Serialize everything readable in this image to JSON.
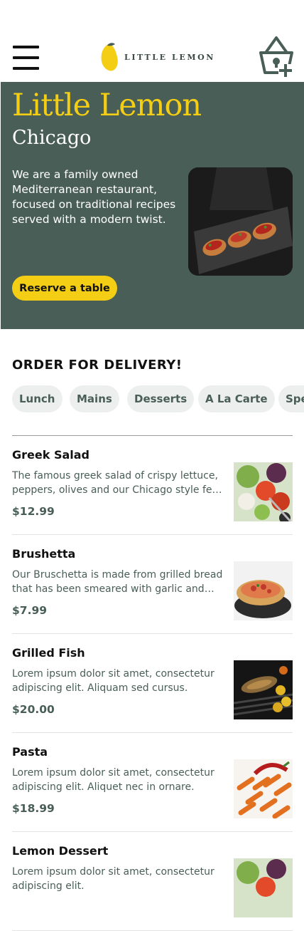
{
  "header": {
    "logo_text": "LITTLE LEMON",
    "menu_icon": "hamburger-icon",
    "cart_icon": "basket-add-icon"
  },
  "hero": {
    "title": "Little Lemon",
    "subtitle": "Chicago",
    "description": "We are a family owned Mediterranean restaurant, focused on traditional recipes served with a modern twist.",
    "button": "Reserve a table"
  },
  "order": {
    "title": "ORDER FOR DELIVERY!",
    "categories": [
      "Lunch",
      "Mains",
      "Desserts",
      "A La Carte",
      "Specials"
    ]
  },
  "menu": [
    {
      "name": "Greek Salad",
      "description": "The famous greek salad of crispy lettuce, peppers, olives and our Chicago style feta cheese, garnished with crunchy garlic and rosemary croutons.",
      "price": "$12.99"
    },
    {
      "name": "Brushetta",
      "description": "Our Bruschetta is made from grilled bread that has been smeared with garlic and seasoned with salt and olive oil.",
      "price": "$7.99"
    },
    {
      "name": "Grilled Fish",
      "description": "Lorem ipsum dolor sit amet, consectetur adipiscing elit. Aliquam sed cursus.",
      "price": "$20.00"
    },
    {
      "name": "Pasta",
      "description": "Lorem ipsum dolor sit amet, consectetur adipiscing elit. Aliquet nec in ornare.",
      "price": "$18.99"
    },
    {
      "name": "Lemon Dessert",
      "description": "Lorem ipsum dolor sit amet, consectetur adipiscing elit.",
      "price": ""
    }
  ],
  "colors": {
    "primary_green": "#495e57",
    "primary_yellow": "#f4ce14",
    "chip_bg": "#edefee"
  }
}
